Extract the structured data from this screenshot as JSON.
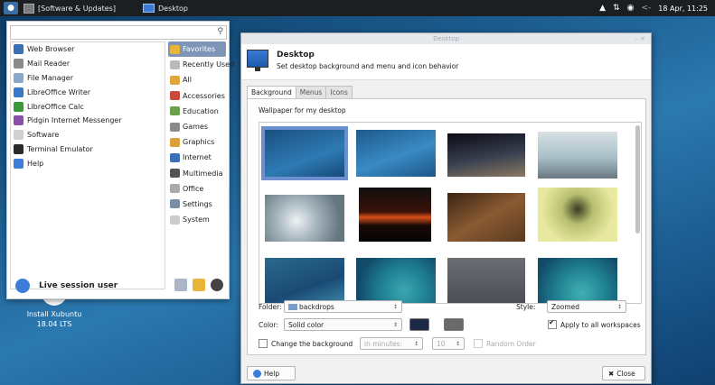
{
  "panel": {
    "windows": [
      "[Software & Updates]",
      "Desktop"
    ],
    "date": "18 Apr, 11:25"
  },
  "desktop": {
    "icon_label_line1": "Install Xubuntu",
    "icon_label_line2": "18.04 LTS"
  },
  "menu": {
    "search_placeholder": "",
    "apps": [
      {
        "label": "Web Browser",
        "icon": "globe-icon",
        "color": "#3b6fb6"
      },
      {
        "label": "Mail Reader",
        "icon": "mail-icon",
        "color": "#8a8a8a"
      },
      {
        "label": "File Manager",
        "icon": "folder-icon",
        "color": "#8aa9c9"
      },
      {
        "label": "LibreOffice Writer",
        "icon": "writer-icon",
        "color": "#3a79c8"
      },
      {
        "label": "LibreOffice Calc",
        "icon": "calc-icon",
        "color": "#3a9a3a"
      },
      {
        "label": "Pidgin Internet Messenger",
        "icon": "pidgin-icon",
        "color": "#8a4fa8"
      },
      {
        "label": "Software",
        "icon": "software-icon",
        "color": "#d0d0d0"
      },
      {
        "label": "Terminal Emulator",
        "icon": "terminal-icon",
        "color": "#2a2a2a"
      },
      {
        "label": "Help",
        "icon": "help-icon",
        "color": "#3b7dd8"
      }
    ],
    "categories": [
      {
        "label": "Favorites",
        "icon": "star-icon",
        "color": "#e8b43a",
        "selected": true
      },
      {
        "label": "Recently Used",
        "icon": "clock-icon",
        "color": "#bbbbbb",
        "selected": false
      },
      {
        "label": "All",
        "icon": "all-icon",
        "color": "#e0a53c",
        "selected": false
      },
      {
        "label": "Accessories",
        "icon": "accessories-icon",
        "color": "#c94a3a",
        "selected": false
      },
      {
        "label": "Education",
        "icon": "education-icon",
        "color": "#6aa04a",
        "selected": false
      },
      {
        "label": "Games",
        "icon": "games-icon",
        "color": "#8a8a8a",
        "selected": false
      },
      {
        "label": "Graphics",
        "icon": "graphics-icon",
        "color": "#d9a23a",
        "selected": false
      },
      {
        "label": "Internet",
        "icon": "internet-icon",
        "color": "#3b6fb6",
        "selected": false
      },
      {
        "label": "Multimedia",
        "icon": "multimedia-icon",
        "color": "#555555",
        "selected": false
      },
      {
        "label": "Office",
        "icon": "office-icon",
        "color": "#aaaaaa",
        "selected": false
      },
      {
        "label": "Settings",
        "icon": "settings-icon",
        "color": "#7a8ea8",
        "selected": false
      },
      {
        "label": "System",
        "icon": "system-icon",
        "color": "#cccccc",
        "selected": false
      }
    ],
    "user": "Live session user"
  },
  "dialog": {
    "titlebar": "Desktop",
    "title": "Desktop",
    "subtitle": "Set desktop background and menu and icon behavior",
    "tabs": [
      "Background",
      "Menus",
      "Icons"
    ],
    "wallpaper_caption": "Wallpaper for my desktop",
    "folder_label": "Folder:",
    "folder_value": "backdrops",
    "style_label": "Style:",
    "style_value": "Zoomed",
    "color_label": "Color:",
    "color_value": "Solid color",
    "apply_all": "Apply to all workspaces",
    "change_bg": "Change the background",
    "interval_unit": "in minutes:",
    "interval_value": "10",
    "random_order": "Random Order",
    "help": "Help",
    "close": "Close",
    "color1": "#1a2a44",
    "color2": "#6a6a6a"
  }
}
